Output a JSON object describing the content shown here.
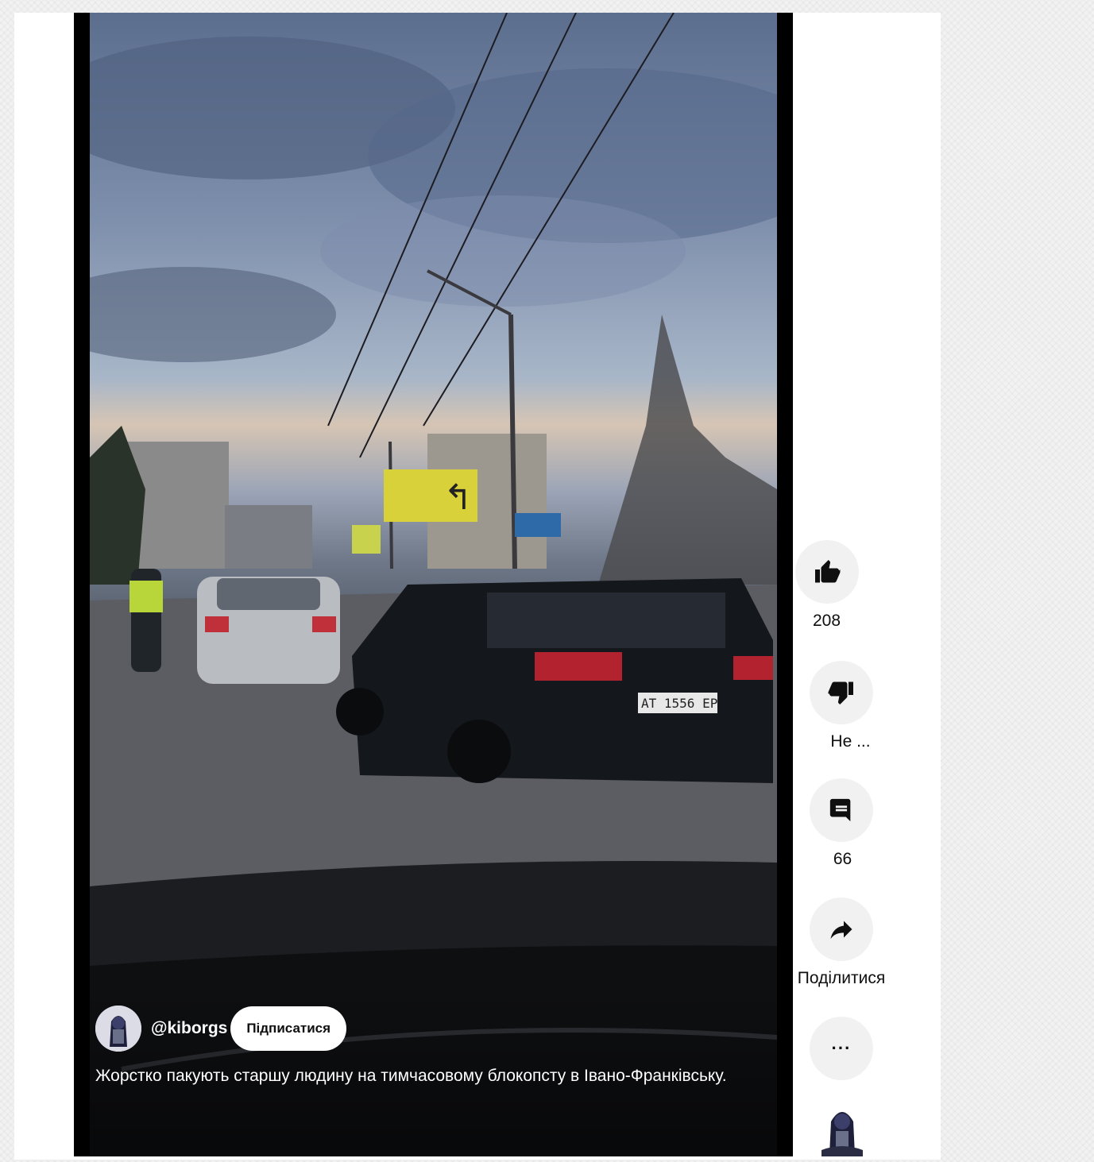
{
  "channel": {
    "handle": "@kiborgs",
    "subscribe_label": "Підписатися"
  },
  "video": {
    "caption": "Жорстко пакують старшу людину на тимчасовому блокопсту в Івано-Франківську.",
    "scene": {
      "billboard_arrow": "↰",
      "plate": "AT 1556 EP"
    }
  },
  "actions": {
    "like_count": "208",
    "dislike_label": "Не ...",
    "comment_count": "66",
    "share_label": "Поділитися",
    "more_label": "···"
  },
  "colors": {
    "action_bg": "#f1f1f1",
    "subscribe_bg": "#ffffff",
    "text": "#0f0f0f"
  },
  "icons": [
    "thumbs-up-icon",
    "thumbs-down-icon",
    "comment-icon",
    "share-icon",
    "more-icon"
  ]
}
